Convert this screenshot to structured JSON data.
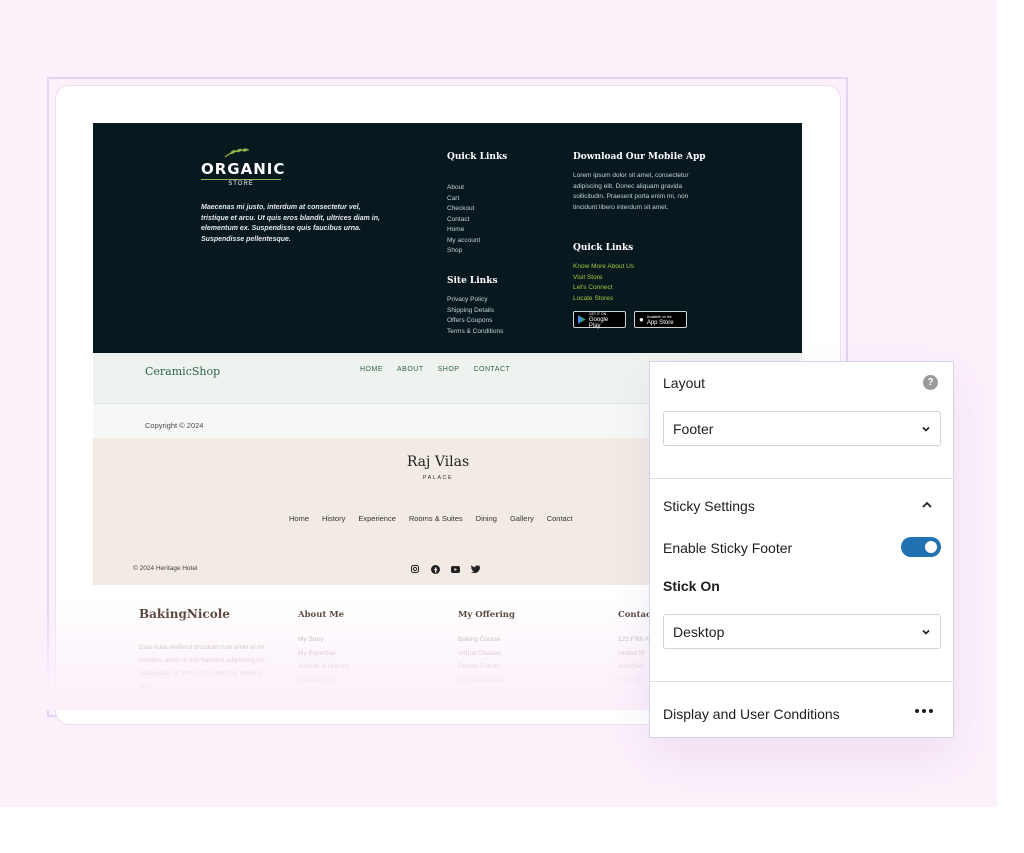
{
  "organic": {
    "logo_title": "ORGANIC",
    "logo_sub": "STORE",
    "description": "Maecenas mi justo, interdum at consectetur vel, tristique et arcu. Ut quis eros blandit, ultrices diam in, elementum ex. Suspendisse quis faucibus urna. Suspendisse pellentesque.",
    "quick_links_title": "Quick Links",
    "quick_links": [
      "About",
      "Cart",
      "Checkout",
      "Contact",
      "Home",
      "My account",
      "Shop"
    ],
    "site_links_title": "Site Links",
    "site_links": [
      "Privacy Policy",
      "Shipping Details",
      "Offers Coupons",
      "Terms & Conditions"
    ],
    "app_title": "Download Our Mobile App",
    "app_text": "Lorem ipsum dolor sit amet, consectetur adipiscing elit. Donec aliquam gravida sollicitudin. Praesent porta enim mi, non tincidunt libero interdum sit amet.",
    "quick_links2_title": "Quick Links",
    "quick_links2": [
      "Know More About Us",
      "Visit Store",
      "Let's Connect",
      "Locate Stores"
    ],
    "google_play_small": "GET IT ON",
    "google_play": "Google Play",
    "app_store_small": "Available on the",
    "app_store": "App Store"
  },
  "ceramic": {
    "logo": "CeramicShop",
    "nav": [
      "HOME",
      "ABOUT",
      "SHOP",
      "CONTACT"
    ],
    "copyright": "Copyright © 2024"
  },
  "raj": {
    "title": "Raj Vilas",
    "subtitle": "PALACE",
    "nav": [
      "Home",
      "History",
      "Experience",
      "Rooms & Suites",
      "Dining",
      "Gallery",
      "Contact"
    ],
    "copyright": "© 2024 Heritage Hotel"
  },
  "baking": {
    "logo": "BakingNicole",
    "desc": "Duis nulla eleifend tincidunt cum amet id mi sodales, amet ut non habitant adipiscing mi, malesuada sit nibh consectetur tur offere es ique",
    "about_title": "About Me",
    "about": [
      "My Story",
      "My Expertise",
      "Awards & Honors",
      "News & Blog"
    ],
    "offering_title": "My Offering",
    "offering": [
      "Baking Course",
      "Virtual Classes",
      "Private Events",
      "Gift Certificates"
    ],
    "contact_title": "Contac",
    "contact": [
      "123 Fifth A",
      "United St",
      "mail@ex",
      "+01 - 23"
    ]
  },
  "panel": {
    "layout_title": "Layout",
    "layout_value": "Footer",
    "sticky_title": "Sticky Settings",
    "enable_label": "Enable Sticky Footer",
    "enable_on": true,
    "stick_on_title": "Stick On",
    "stick_on_value": "Desktop",
    "conditions_title": "Display and User Conditions",
    "toggle_color": "#2271b1"
  }
}
